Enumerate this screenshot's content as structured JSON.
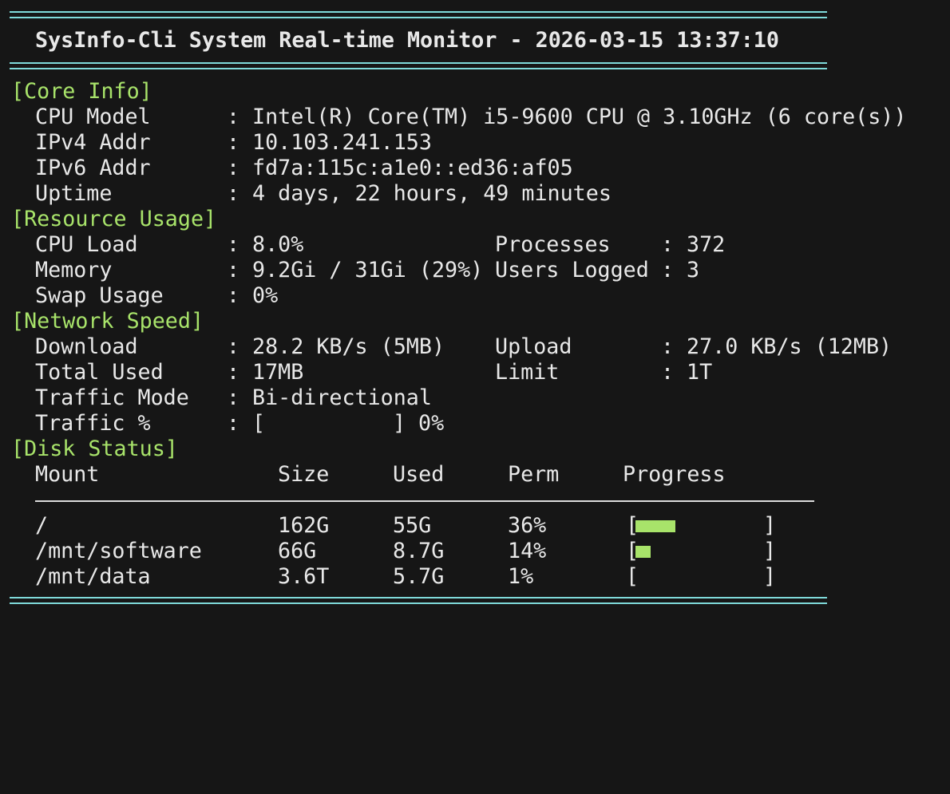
{
  "header": {
    "title": "SysInfo-Cli System Real-time Monitor - 2026-03-15 13:37:10"
  },
  "core_info": {
    "heading": "[Core Info]",
    "rows": [
      {
        "label": "CPU Model",
        "value": "Intel(R) Core(TM) i5-9600 CPU @ 3.10GHz (6 core(s))"
      },
      {
        "label": "IPv4 Addr",
        "value": "10.103.241.153"
      },
      {
        "label": "IPv6 Addr",
        "value": "fd7a:115c:a1e0::ed36:af05"
      },
      {
        "label": "Uptime",
        "value": "4 days, 22 hours, 49 minutes"
      }
    ]
  },
  "resource_usage": {
    "heading": "[Resource Usage]",
    "cpu_label": "CPU Load",
    "cpu_value": "8.0%",
    "processes_label": "Processes",
    "processes_value": "372",
    "memory_label": "Memory",
    "memory_value": "9.2Gi / 31Gi (29%)",
    "users_label": "Users Logged",
    "users_value": "3",
    "swap_label": "Swap Usage",
    "swap_value": "0%"
  },
  "network_speed": {
    "heading": "[Network Speed]",
    "download_label": "Download",
    "download_value": "28.2 KB/s (5MB)",
    "upload_label": "Upload",
    "upload_value": "27.0 KB/s (12MB)",
    "total_label": "Total Used",
    "total_value": "17MB",
    "limit_label": "Limit",
    "limit_value": "1T",
    "mode_label": "Traffic Mode",
    "mode_value": "Bi-directional",
    "traffic_label": "Traffic %",
    "traffic_bar_open": "[",
    "traffic_bar_close": "]",
    "traffic_percent_text": "0%",
    "traffic_fraction": 0.0
  },
  "disk_status": {
    "heading": "[Disk Status]",
    "columns": [
      "Mount",
      "Size",
      "Used",
      "Perm",
      "Progress"
    ],
    "rows": [
      {
        "mount": "/",
        "size": "162G",
        "used": "55G",
        "perm": "36%",
        "fraction": 0.36
      },
      {
        "mount": "/mnt/software",
        "size": "66G",
        "used": "8.7G",
        "perm": "14%",
        "fraction": 0.14
      },
      {
        "mount": "/mnt/data",
        "size": "3.6T",
        "used": "5.7G",
        "perm": "1%",
        "fraction": 0.01
      }
    ],
    "bar_open": "[",
    "bar_close": "]"
  },
  "separator_char": ":",
  "colors": {
    "background": "#161616",
    "text": "#e8e8e8",
    "section": "#a8e36a",
    "rule": "#7fdada",
    "bar_fill": "#a8e36a"
  }
}
